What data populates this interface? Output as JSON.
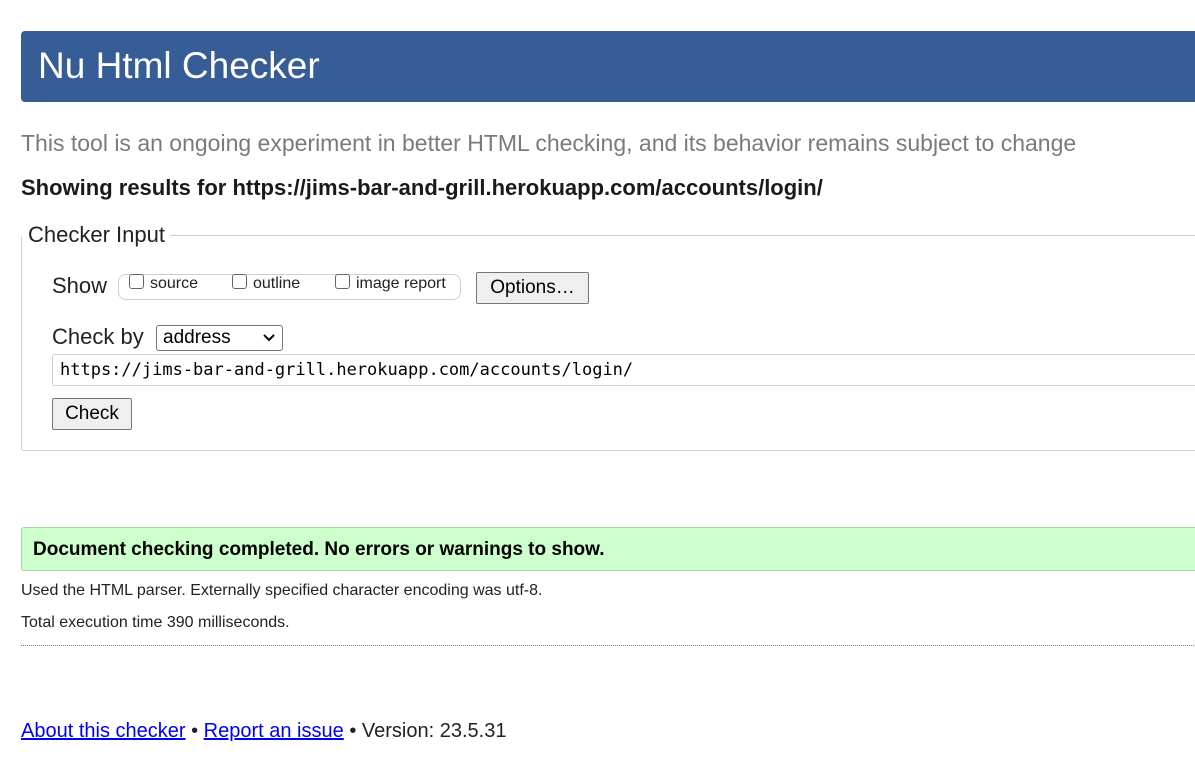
{
  "header": {
    "title": "Nu Html Checker"
  },
  "tagline": "This tool is an ongoing experiment in better HTML checking, and its behavior remains subject to change",
  "results_heading": "Showing results for https://jims-bar-and-grill.herokuapp.com/accounts/login/",
  "checker_input": {
    "legend": "Checker Input",
    "show_label": "Show",
    "show_options": [
      {
        "label": "source",
        "checked": false
      },
      {
        "label": "outline",
        "checked": false
      },
      {
        "label": "image report",
        "checked": false
      }
    ],
    "options_button": "Options…",
    "check_by_label": "Check by",
    "check_by_selected": "address",
    "url_value": "https://jims-bar-and-grill.herokuapp.com/accounts/login/",
    "check_button": "Check"
  },
  "result": {
    "success_message": "Document checking completed. No errors or warnings to show.",
    "parser_info": "Used the HTML parser. Externally specified character encoding was utf-8.",
    "execution_time": "Total execution time 390 milliseconds."
  },
  "footer": {
    "about_link": "About this checker",
    "separator": "•",
    "report_link": "Report an issue",
    "version_text": "Version: 23.5.31"
  },
  "icons": {
    "select_chevron": "chevron-down-icon"
  }
}
